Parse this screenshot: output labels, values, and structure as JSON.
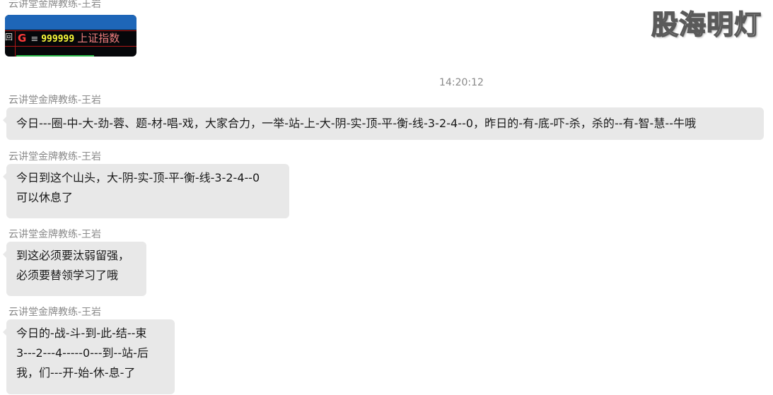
{
  "watermark": "股海明灯",
  "timestamp": "14:20:12",
  "colors": {
    "bubble_bg": "#e8e8e8",
    "sender_text": "#8a8a8a",
    "message_text": "#191919",
    "stock_code": "#ffff3a",
    "stock_name": "#f07f7f",
    "stock_marker": "#ff3b3b"
  },
  "image_message": {
    "sender": "云讲堂金牌教练-王岩",
    "marker": "G",
    "separator": "≡",
    "stock_code": "999999",
    "stock_name": "上证指数",
    "edge_glyph": "回"
  },
  "messages": [
    {
      "sender": "云讲堂金牌教练-王岩",
      "lines": [
        "今日---圈-中-大-劲-蓉、题-材-唱-戏，大家合力，一举-站-上-大-阴-实-顶-平-衡-线-3-2-4--0，昨日的-有-底-吓-杀，杀的--有-智-慧--牛哦"
      ]
    },
    {
      "sender": "云讲堂金牌教练-王岩",
      "lines": [
        "今日到这个山头，大-阴-实-顶-平-衡-线-3-2-4--0",
        "可以休息了"
      ]
    },
    {
      "sender": "云讲堂金牌教练-王岩",
      "lines": [
        "到这必须要汰弱留强，",
        "必须要替领学习了哦"
      ]
    },
    {
      "sender": "云讲堂金牌教练-王岩",
      "lines": [
        "今日的-战-斗-到-此-结--束",
        "3---2---4-----0---到--站-后",
        "我，们---开-始-休-息-了"
      ]
    }
  ]
}
